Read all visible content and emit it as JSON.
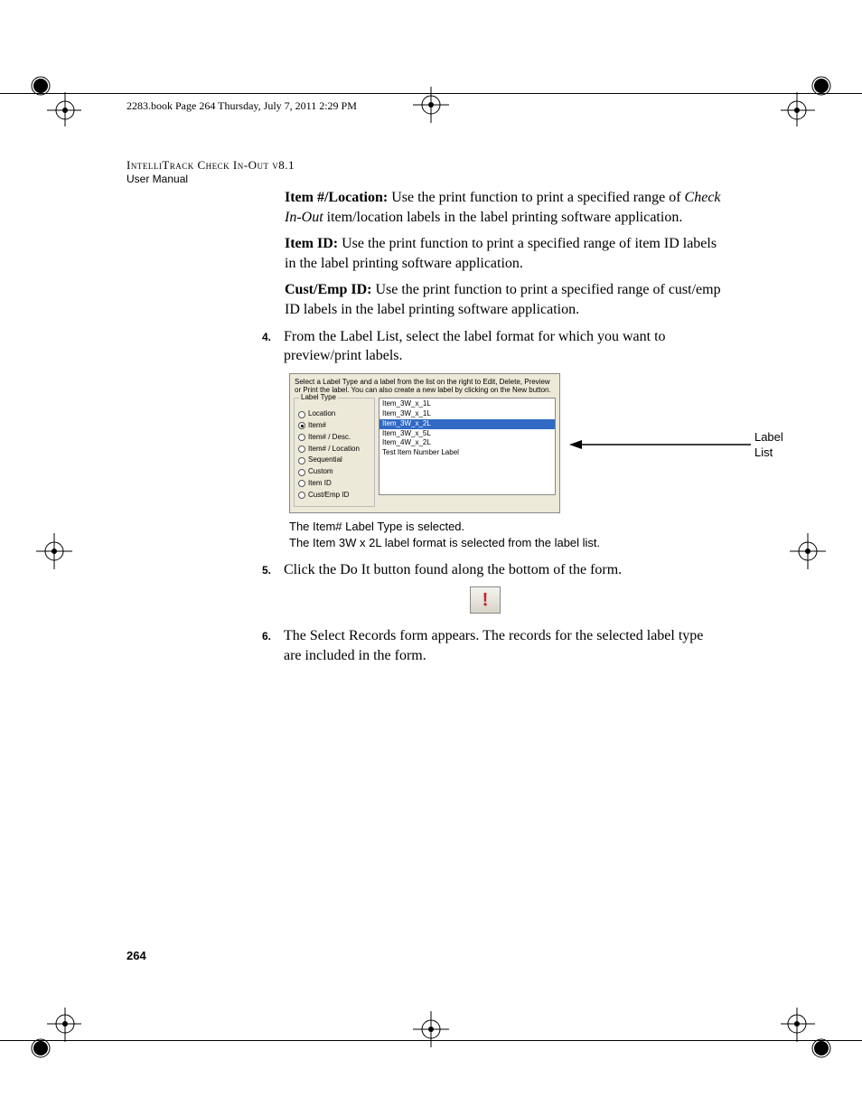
{
  "header_note": "2283.book  Page 264  Thursday, July 7, 2011  2:29 PM",
  "doc_title_line1": "IntelliTrack Check In-Out v8.1",
  "doc_title_line2": "User Manual",
  "p1": {
    "head": "Item #/Location:",
    "body1": " Use the print function to print a specified range of ",
    "ital": "Check In-Out",
    "body2": " item/location labels in the label printing software application."
  },
  "p2": {
    "head": "Item ID:",
    "body": " Use the print function to print a specified range of item ID labels in the label printing software application."
  },
  "p3": {
    "head": "Cust/Emp ID:",
    "body": " Use the print function to print a specified range of cust/emp ID labels in the label printing software application."
  },
  "step4": {
    "num": "4.",
    "t1": "From the ",
    "b1": "Label List",
    "t2": ", select the label format for which you want to preview/print labels."
  },
  "panel": {
    "instr": "Select a Label Type and a label from the list on the right to Edit, Delete, Preview or Print the label. You can also create a new label by clicking on the New button.",
    "group_legend": "Label Type",
    "radios": [
      {
        "label": "Location",
        "selected": false
      },
      {
        "label": "Item#",
        "selected": true
      },
      {
        "label": "Item# / Desc.",
        "selected": false
      },
      {
        "label": "Item# / Location",
        "selected": false
      },
      {
        "label": "Sequential",
        "selected": false
      },
      {
        "label": "Custom",
        "selected": false
      },
      {
        "label": "Item ID",
        "selected": false
      },
      {
        "label": "Cust/Emp ID",
        "selected": false
      }
    ],
    "list": [
      {
        "label": "Item_3W_x_1L",
        "selected": false
      },
      {
        "label": "Item_3W_x_1L",
        "selected": false
      },
      {
        "label": "Item_3W_x_2L",
        "selected": true
      },
      {
        "label": "Item_3W_x_5L",
        "selected": false
      },
      {
        "label": "Item_4W_x_2L",
        "selected": false
      },
      {
        "label": "Test Item Number Label",
        "selected": false
      }
    ]
  },
  "callout_label": "Label List",
  "caption1": "The Item# Label Type is selected.",
  "caption2": "The Item 3W x 2L label format is selected from the label list.",
  "step5": {
    "num": "5.",
    "t1": "Click the ",
    "b1": "Do It",
    "t2": " button found along the bottom of the form."
  },
  "doit_icon": "!",
  "step6": {
    "num": "6.",
    "t1": "The Select Records form appears. The records for the selected label type are included in the form."
  },
  "page_number": "264"
}
